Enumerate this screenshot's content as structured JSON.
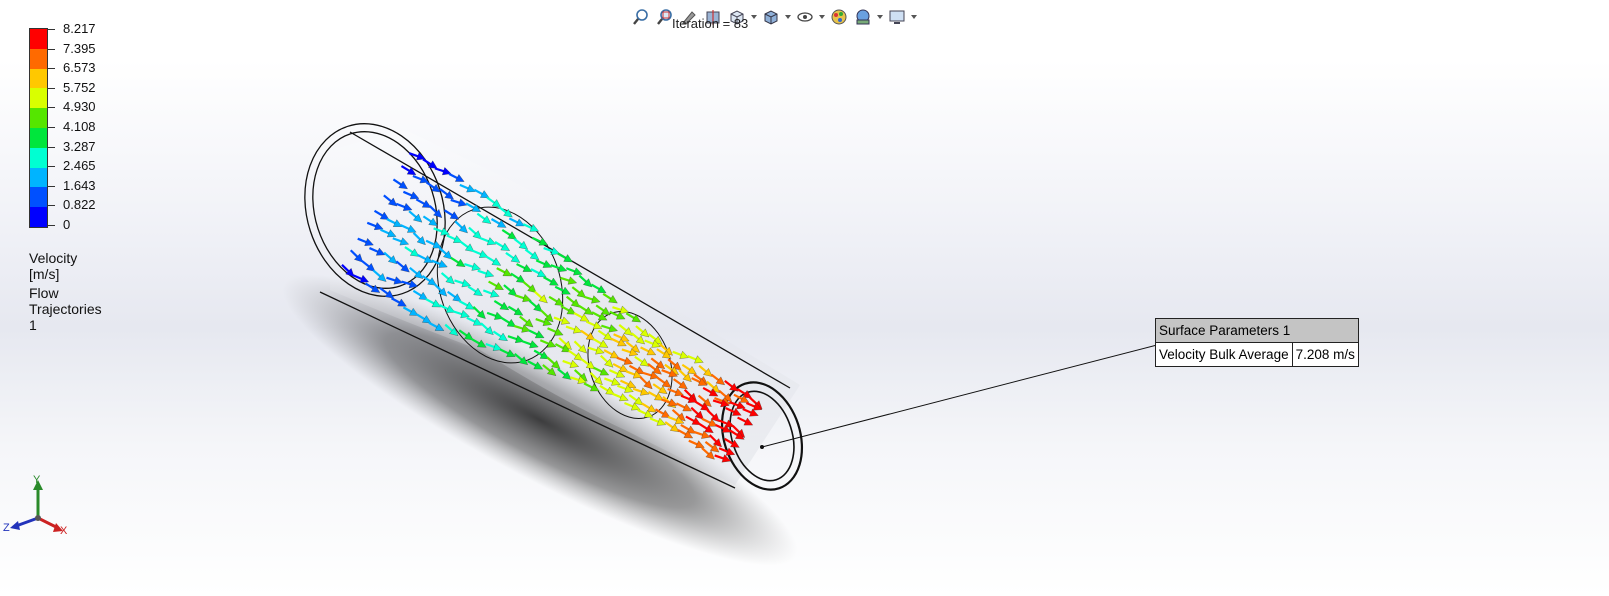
{
  "toolbar": {
    "iteration_text": "Iteration = 83",
    "icons": [
      "zoom-to-fit-icon",
      "zoom-area-icon",
      "previous-view-icon",
      "section-view-icon",
      "view-orientation-icon",
      "display-style-icon",
      "hide-show-items-icon",
      "edit-appearance-icon",
      "apply-scene-icon",
      "view-settings-icon"
    ]
  },
  "legend": {
    "tick_values": [
      "8.217",
      "7.395",
      "6.573",
      "5.752",
      "4.930",
      "4.108",
      "3.287",
      "2.465",
      "1.643",
      "0.822",
      "0"
    ],
    "colors": [
      "#ff0000",
      "#ff6a00",
      "#ffc800",
      "#d9ff00",
      "#55e600",
      "#00e63c",
      "#00ffd2",
      "#00b4ff",
      "#0050ff",
      "#0000ff"
    ],
    "quantity_label": "Velocity [m/s]",
    "plot_label": "Flow Trajectories 1"
  },
  "callout": {
    "title": "Surface Parameters 1",
    "param_name": "Velocity Bulk Average",
    "param_value": "7.208 m/s"
  },
  "triad": {
    "x": "X",
    "y": "Y",
    "z": "Z"
  }
}
